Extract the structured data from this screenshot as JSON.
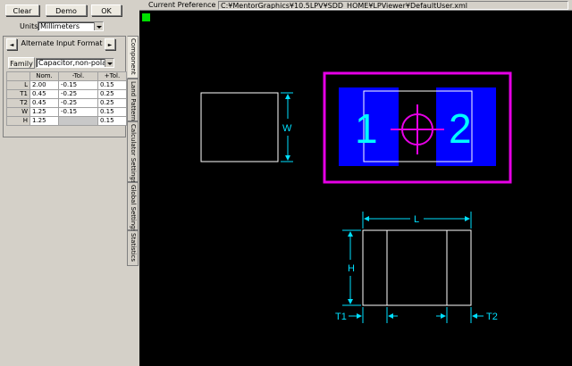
{
  "toolbar": {
    "clear_label": "Clear",
    "demo_label": "Demo",
    "ok_label": "OK"
  },
  "units": {
    "label": "Units",
    "value": "Millimeters"
  },
  "format": {
    "label": "Alternate Input Format",
    "prev_glyph": "◄",
    "next_glyph": "►"
  },
  "family": {
    "label": "Family",
    "value": "Capacitor,non-polarized"
  },
  "table": {
    "headers": [
      "",
      "Nom.",
      "-Tol.",
      "+Tol."
    ],
    "rows": [
      {
        "name": "L",
        "nom": "2.00",
        "minus": "-0.15",
        "plus": "0.15"
      },
      {
        "name": "T1",
        "nom": "0.45",
        "minus": "-0.25",
        "plus": "0.25"
      },
      {
        "name": "T2",
        "nom": "0.45",
        "minus": "-0.25",
        "plus": "0.25"
      },
      {
        "name": "W",
        "nom": "1.25",
        "minus": "-0.15",
        "plus": "0.15"
      },
      {
        "name": "H",
        "nom": "1.25",
        "minus": "",
        "plus": "0.15"
      }
    ]
  },
  "tabs": [
    "Component",
    "Land Pattern",
    "Calculator Settings",
    "Global Settings",
    "Statistics"
  ],
  "preference": {
    "label": "Current Preference File:",
    "path": "C:¥MentorGraphics¥10.5LPV¥SDD_HOME¥LPViewer¥DefaultUser.xml"
  },
  "drawing": {
    "pad1_label": "1",
    "pad2_label": "2",
    "dim_w": "W",
    "dim_l": "L",
    "dim_h": "H",
    "dim_t1": "T1",
    "dim_t2": "T2",
    "colors": {
      "background": "#000000",
      "courtyard": "#e600e6",
      "pad": "#0000ff",
      "pad_number": "#00ffff",
      "dimension": "#00e0ff",
      "body_outline": "#ffffff",
      "status": "#00e000"
    }
  }
}
